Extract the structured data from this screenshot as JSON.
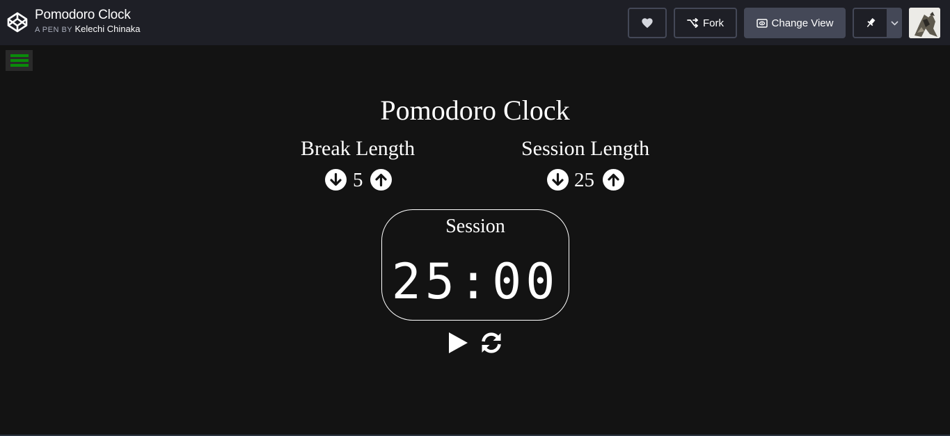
{
  "header": {
    "title": "Pomodoro Clock",
    "by_prefix": "A PEN BY",
    "author": "Kelechi Chinaka",
    "fork_label": "Fork",
    "change_view_label": "Change View"
  },
  "app": {
    "title": "Pomodoro Clock",
    "break": {
      "label": "Break Length",
      "value": "5"
    },
    "session": {
      "label": "Session Length",
      "value": "25"
    },
    "clock": {
      "label": "Session",
      "time": "25:00"
    }
  },
  "colors": {
    "header_bg": "#1e1f26",
    "page_bg": "#131313",
    "menu_accent": "#0a8a0a",
    "button_border": "#444857"
  },
  "icons": {
    "logo": "codepen-logo-icon",
    "heart": "heart-icon",
    "fork": "fork-icon",
    "change_view": "eye-icon",
    "pin": "pin-icon",
    "dropdown": "chevron-down-icon",
    "menu": "hamburger-icon",
    "decrement": "arrow-down-circle-icon",
    "increment": "arrow-up-circle-icon",
    "play": "play-icon",
    "reset": "refresh-icon"
  }
}
